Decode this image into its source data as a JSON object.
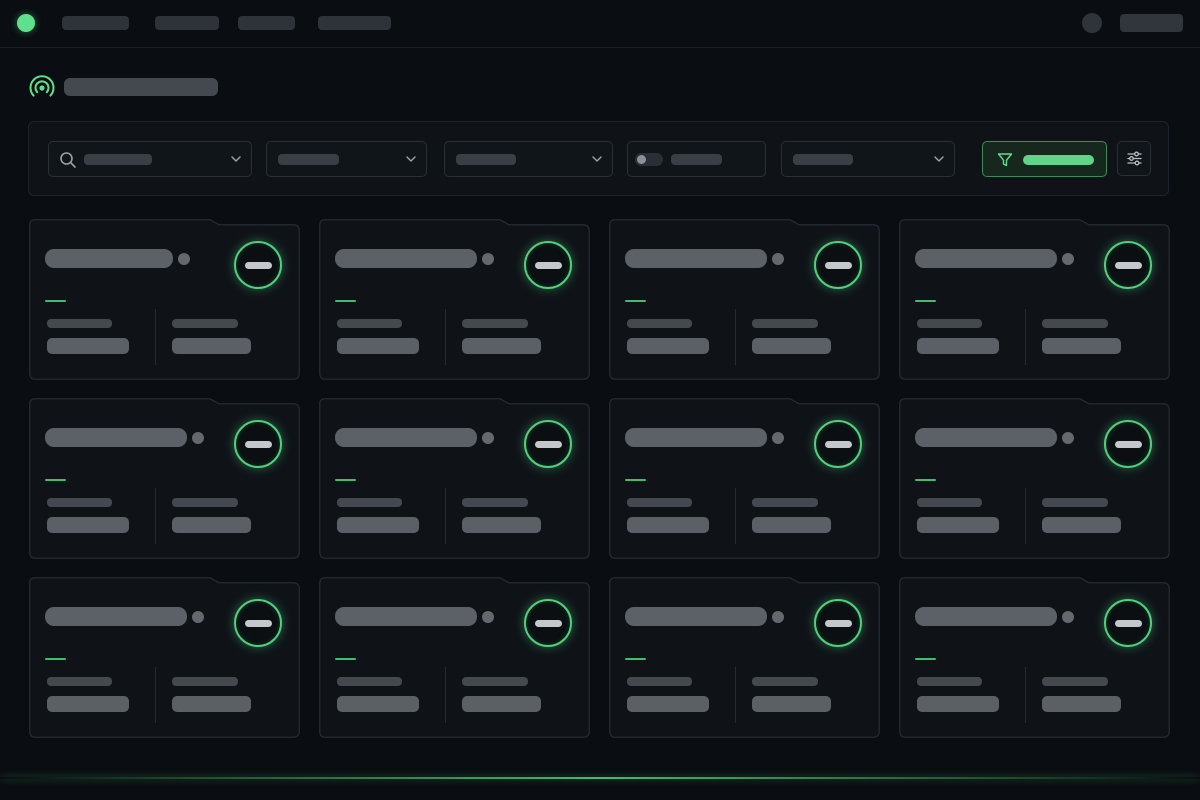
{
  "theme": {
    "accent": "#5ee08c",
    "accent_dim": "#3fbf6c",
    "background": "#0a0d11",
    "surface": "#0f1318"
  },
  "nav": {
    "brand_icon": "brand-dot-icon",
    "items": [
      "",
      "",
      "",
      ""
    ],
    "user": {
      "avatar_icon": "avatar",
      "name": ""
    }
  },
  "page": {
    "icon": "broadcast-signal-icon",
    "title": ""
  },
  "filters": {
    "search": {
      "icon": "search-icon",
      "placeholder": ""
    },
    "select_1": {
      "value": ""
    },
    "select_2": {
      "value": ""
    },
    "toggle": {
      "on": false,
      "label": ""
    },
    "select_3": {
      "value": ""
    },
    "apply": {
      "icon": "filter-funnel-icon",
      "label": ""
    },
    "settings": {
      "icon": "sliders-icon"
    }
  },
  "cards": [
    {
      "title": "",
      "status": "",
      "label_1": "",
      "value_1": "",
      "label_2": "",
      "value_2": ""
    },
    {
      "title": "",
      "status": "",
      "label_1": "",
      "value_1": "",
      "label_2": "",
      "value_2": ""
    },
    {
      "title": "",
      "status": "",
      "label_1": "",
      "value_1": "",
      "label_2": "",
      "value_2": ""
    },
    {
      "title": "",
      "status": "",
      "label_1": "",
      "value_1": "",
      "label_2": "",
      "value_2": ""
    },
    {
      "title": "",
      "status": "",
      "label_1": "",
      "value_1": "",
      "label_2": "",
      "value_2": ""
    },
    {
      "title": "",
      "status": "",
      "label_1": "",
      "value_1": "",
      "label_2": "",
      "value_2": ""
    },
    {
      "title": "",
      "status": "",
      "label_1": "",
      "value_1": "",
      "label_2": "",
      "value_2": ""
    },
    {
      "title": "",
      "status": "",
      "label_1": "",
      "value_1": "",
      "label_2": "",
      "value_2": ""
    },
    {
      "title": "",
      "status": "",
      "label_1": "",
      "value_1": "",
      "label_2": "",
      "value_2": ""
    },
    {
      "title": "",
      "status": "",
      "label_1": "",
      "value_1": "",
      "label_2": "",
      "value_2": ""
    },
    {
      "title": "",
      "status": "",
      "label_1": "",
      "value_1": "",
      "label_2": "",
      "value_2": ""
    },
    {
      "title": "",
      "status": "",
      "label_1": "",
      "value_1": "",
      "label_2": "",
      "value_2": ""
    }
  ]
}
